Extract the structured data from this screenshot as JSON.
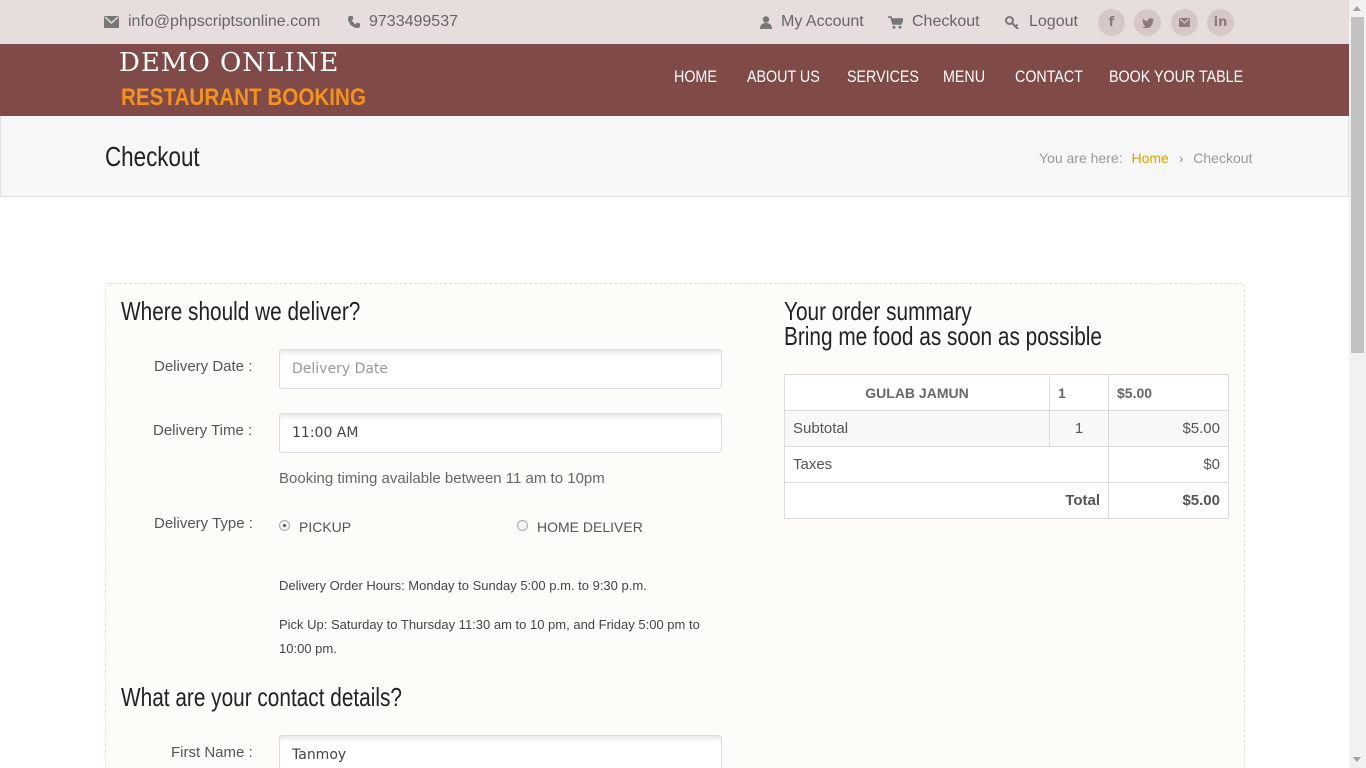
{
  "topbar": {
    "email": "info@phpscriptsonline.com",
    "phone": "9733499537",
    "my_account": "My Account",
    "checkout": "Checkout",
    "logout": "Logout",
    "social": [
      "f",
      "t",
      "m",
      "in"
    ]
  },
  "logo": {
    "line1": "DEMO ONLINE",
    "line2": "RESTAURANT BOOKING"
  },
  "nav": [
    "HOME",
    "ABOUT US",
    "SERVICES",
    "MENU",
    "CONTACT",
    "BOOK YOUR TABLE"
  ],
  "page": {
    "title": "Checkout",
    "breadcrumb": {
      "prefix": "You are here:",
      "home": "Home",
      "separator": "›",
      "current": "Checkout"
    }
  },
  "delivery": {
    "heading": "Where should we deliver?",
    "date_label": "Delivery Date :",
    "date_placeholder": "Delivery Date",
    "time_label": "Delivery Time :",
    "time_value": "11:00 AM",
    "timing_note": "Booking timing available between 11 am to 10pm",
    "type_label": "Delivery Type :",
    "options": [
      "PICKUP",
      "HOME DELIVER"
    ],
    "selected": "PICKUP",
    "hours": "Delivery Order Hours: Monday to Sunday 5:00 p.m. to 9:30 p.m.",
    "pickup_line1": "Pick Up: Saturday to Thursday 11:30 am to 10 pm, and Friday 5:00 pm to",
    "pickup_line2": "10:00 pm."
  },
  "contact": {
    "heading": "What are your contact details?",
    "first_name_label": "First Name :",
    "first_name_value": "Tanmoy"
  },
  "summary": {
    "heading1": "Your order summary",
    "heading2": "Bring me food as soon as possible",
    "item": {
      "name": "GULAB JAMUN",
      "qty": "1",
      "price": "$5.00"
    },
    "subtotal_label": "Subtotal",
    "subtotal_qty": "1",
    "subtotal_value": "$5.00",
    "taxes_label": "Taxes",
    "taxes_value": "$0",
    "total_label": "Total",
    "total_value": "$5.00"
  },
  "colors": {
    "brand": "#7f4a47",
    "accent": "#f5921e",
    "link": "#d9a400"
  }
}
